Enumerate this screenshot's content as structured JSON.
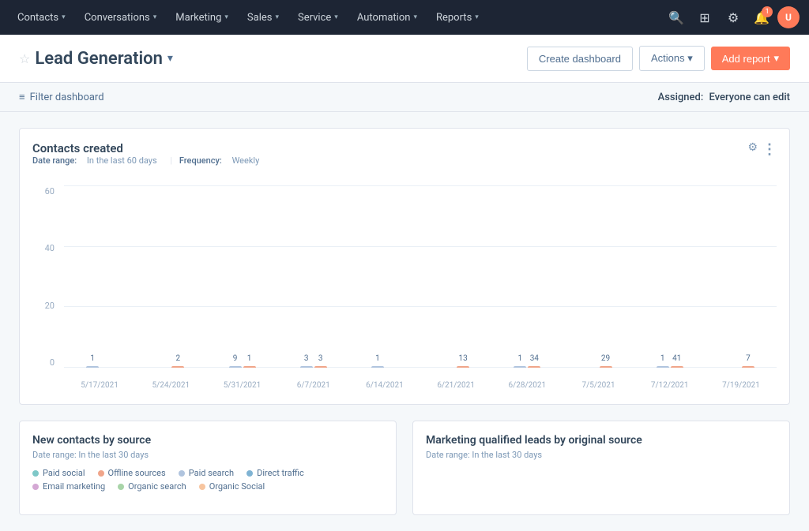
{
  "nav": {
    "items": [
      {
        "label": "Contacts",
        "has_chevron": true
      },
      {
        "label": "Conversations",
        "has_chevron": true
      },
      {
        "label": "Marketing",
        "has_chevron": true
      },
      {
        "label": "Sales",
        "has_chevron": true
      },
      {
        "label": "Service",
        "has_chevron": true
      },
      {
        "label": "Automation",
        "has_chevron": true
      },
      {
        "label": "Reports",
        "has_chevron": true
      }
    ],
    "icons": [
      "search",
      "grid",
      "settings",
      "bell",
      "avatar"
    ]
  },
  "header": {
    "title": "Lead Generation",
    "create_dashboard_label": "Create dashboard",
    "actions_label": "Actions",
    "add_report_label": "Add report"
  },
  "filter_bar": {
    "filter_label": "Filter dashboard",
    "assigned_label": "Assigned:",
    "assigned_value": "Everyone can edit"
  },
  "chart": {
    "title": "Contacts created",
    "date_range_label": "Date range:",
    "date_range_value": "In the last 60 days",
    "frequency_label": "Frequency:",
    "frequency_value": "Weekly",
    "y_labels": [
      "0",
      "20",
      "40",
      "60"
    ],
    "bars": [
      {
        "x_label": "5/17/2021",
        "values": [
          1,
          0
        ],
        "colors": [
          "#b0c4de",
          "#f0a58a"
        ]
      },
      {
        "x_label": "5/24/2021",
        "values": [
          0,
          2
        ],
        "colors": [
          "#b0c4de",
          "#f0a58a"
        ]
      },
      {
        "x_label": "5/31/2021",
        "values": [
          9,
          1
        ],
        "colors": [
          "#b0c4de",
          "#f0a58a"
        ]
      },
      {
        "x_label": "6/7/2021",
        "values": [
          3,
          3
        ],
        "colors": [
          "#b0c4de",
          "#f0a58a"
        ]
      },
      {
        "x_label": "6/14/2021",
        "values": [
          1,
          0
        ],
        "colors": [
          "#b0c4de",
          "#f0a58a"
        ]
      },
      {
        "x_label": "6/21/2021",
        "values": [
          0,
          13
        ],
        "colors": [
          "#b0c4de",
          "#f0a58a"
        ]
      },
      {
        "x_label": "6/28/2021",
        "values": [
          1,
          34
        ],
        "colors": [
          "#b0c4de",
          "#f0a58a"
        ]
      },
      {
        "x_label": "7/5/2021",
        "values": [
          0,
          29
        ],
        "colors": [
          "#b0c4de",
          "#f0a58a"
        ]
      },
      {
        "x_label": "7/12/2021",
        "values": [
          1,
          41
        ],
        "colors": [
          "#b0c4de",
          "#f0a58a"
        ]
      },
      {
        "x_label": "7/19/2021",
        "values": [
          0,
          7
        ],
        "colors": [
          "#b0c4de",
          "#f0a58a"
        ]
      }
    ],
    "max_value": 60
  },
  "bottom_left": {
    "title": "New contacts by source",
    "date_range": "Date range: In the last 30 days",
    "legend": [
      {
        "label": "Paid social",
        "color": "#7ec8c8"
      },
      {
        "label": "Offline sources",
        "color": "#f0a58a"
      },
      {
        "label": "Paid search",
        "color": "#b0c4de"
      },
      {
        "label": "Direct traffic",
        "color": "#7fb3d3"
      },
      {
        "label": "Email marketing",
        "color": "#d4a8d4"
      },
      {
        "label": "Organic search",
        "color": "#a8d4a8"
      },
      {
        "label": "Organic Social",
        "color": "#f7c59f"
      }
    ]
  },
  "bottom_right": {
    "title": "Marketing qualified leads by original source",
    "date_range": "Date range: In the last 30 days"
  }
}
